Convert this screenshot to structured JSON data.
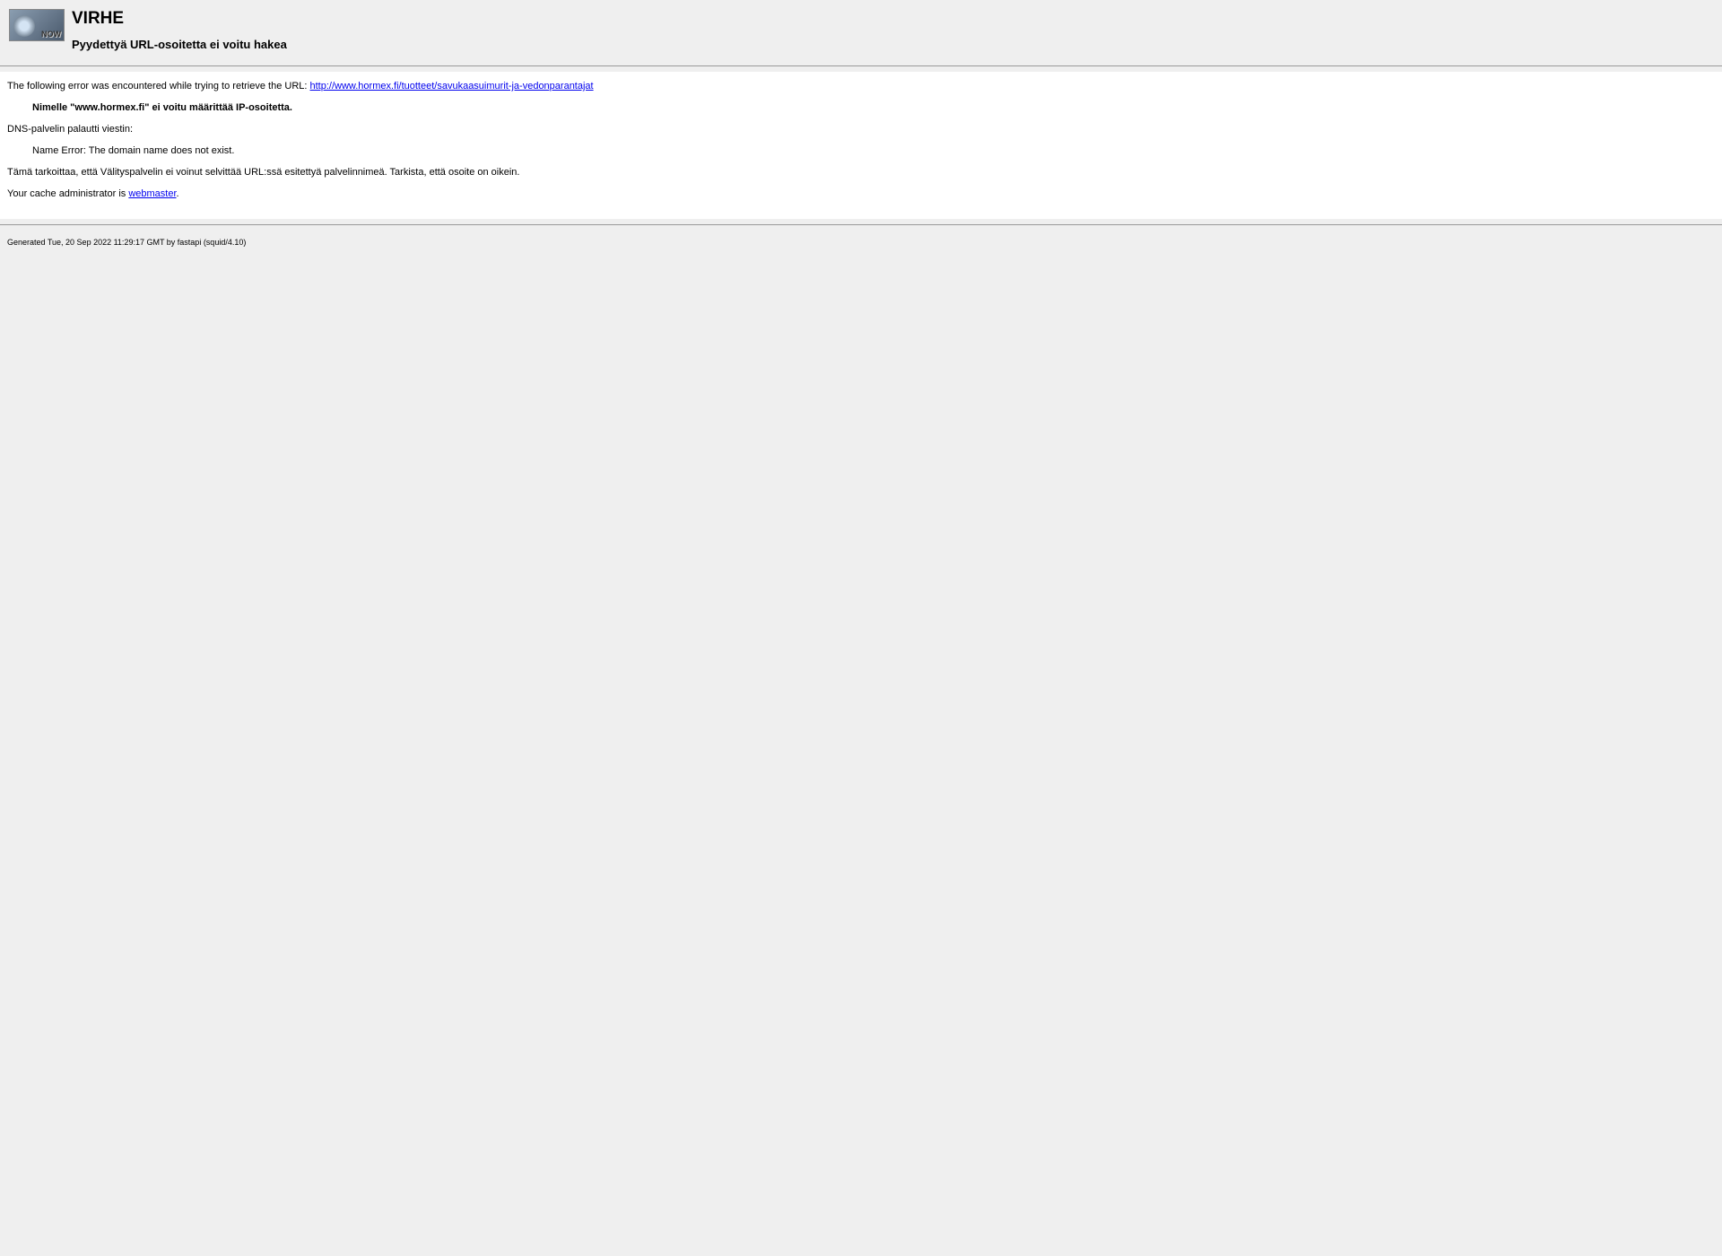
{
  "header": {
    "title": "VIRHE",
    "subtitle": "Pyydettyä URL-osoitetta ei voitu hakea",
    "logo_text": "NOW"
  },
  "content": {
    "intro_text": "The following error was encountered while trying to retrieve the URL: ",
    "url": "http://www.hormex.fi/tuotteet/savukaasuimurit-ja-vedonparantajat",
    "error_bold": "Nimelle \"www.hormex.fi\" ei voitu määrittää IP-osoitetta.",
    "dns_message": "DNS-palvelin palautti viestin:",
    "name_error": "Name Error: The domain name does not exist.",
    "explanation": "Tämä tarkoittaa, että Välityspalvelin ei voinut selvittää URL:ssä esitettyä palvelinnimeä. Tarkista, että osoite on oikein.",
    "admin_prefix": "Your cache administrator is ",
    "admin_link": "webmaster",
    "admin_suffix": "."
  },
  "footer": {
    "generated": "Generated Tue, 20 Sep 2022 11:29:17 GMT by fastapi (squid/4.10)"
  }
}
